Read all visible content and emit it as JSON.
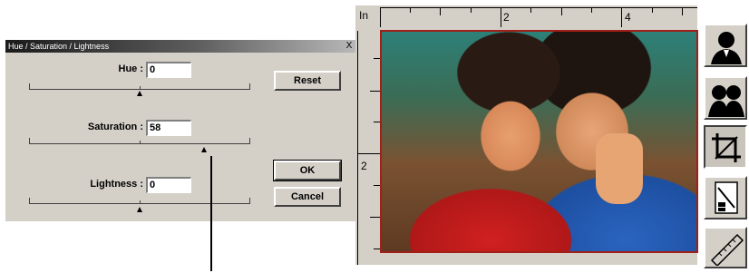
{
  "dialog": {
    "title": "Hue / Saturation / Lightness",
    "close_label": "X",
    "hue": {
      "label": "Hue :",
      "value": "0",
      "slider_fraction": 0.5
    },
    "saturation": {
      "label": "Saturation :",
      "value": "58",
      "slider_fraction": 0.79
    },
    "lightness": {
      "label": "Lightness :",
      "value": "0",
      "slider_fraction": 0.5
    },
    "buttons": {
      "reset": "Reset",
      "ok": "OK",
      "cancel": "Cancel"
    }
  },
  "preview": {
    "ruler_unit": "In",
    "top_ruler_labels": [
      "2",
      "4"
    ],
    "left_ruler_labels": [
      "2"
    ],
    "photo_caption": "",
    "toolbar_icons": [
      "person-silhouette-icon",
      "two-persons-icon",
      "crop-icon",
      "document-scale-icon",
      "ruler-icon"
    ]
  },
  "colors": {
    "dialog_bg": "#d4d0c8",
    "frame_border": "#a02018"
  }
}
